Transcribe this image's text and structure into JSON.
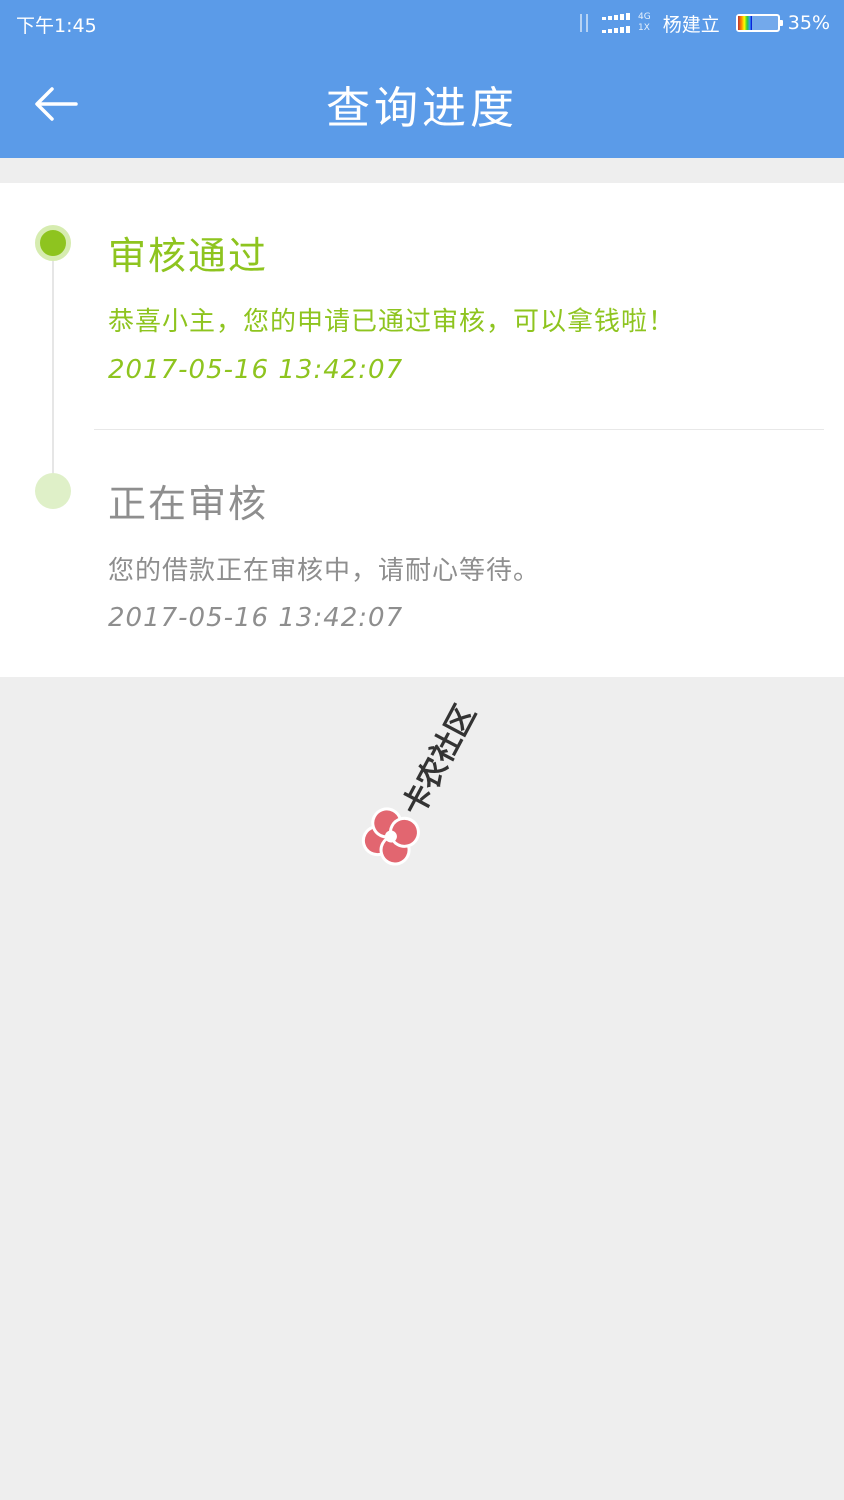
{
  "status_bar": {
    "time": "下午1:45",
    "network_top": "4G",
    "network_bottom": "1X",
    "carrier": "杨建立",
    "battery_percent_text": "35%",
    "battery_level": 0.35
  },
  "header": {
    "title": "查询进度",
    "back_icon": "arrow-left-icon"
  },
  "timeline": {
    "steps": [
      {
        "title": "审核通过",
        "description": "恭喜小主，您的申请已通过审核，可以拿钱啦！",
        "time": "2017-05-16  13:42:07",
        "state": "completed"
      },
      {
        "title": "正在审核",
        "description": "您的借款正在审核中，请耐心等待。",
        "time": "2017-05-16  13:42:07",
        "state": "pending"
      }
    ]
  },
  "watermark": {
    "text": "卡农社区"
  },
  "colors": {
    "header_bg": "#5b9be8",
    "accent_green": "#8ec41f",
    "pending_dot": "#dff0c8",
    "muted_text": "#8e8e8e",
    "page_bg": "#eeeeee"
  }
}
